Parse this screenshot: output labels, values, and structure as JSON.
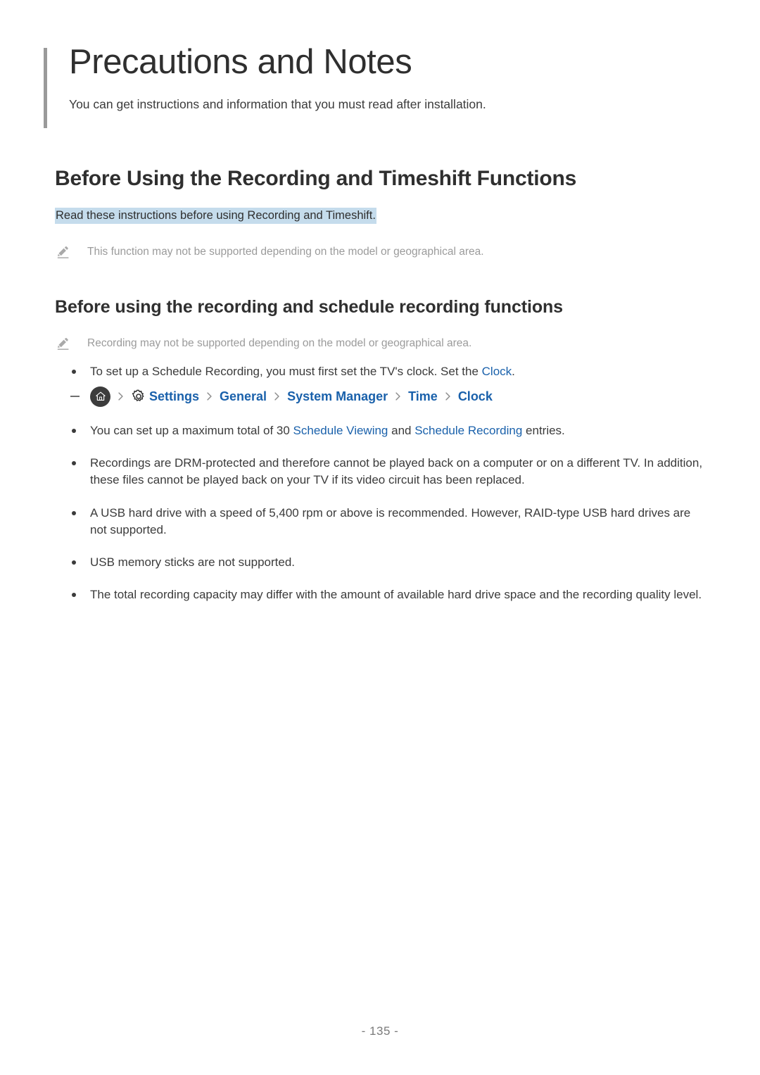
{
  "document": {
    "title": "Precautions and Notes",
    "subtitle": "You can get instructions and information that you must read after installation.",
    "page_number": "- 135 -"
  },
  "colors": {
    "link": "#1a61ab",
    "highlight": "#c5dcec",
    "note_text": "#9b9b9b",
    "body_text": "#3b3b3b",
    "accent_bar": "#9a9a9a"
  },
  "section1": {
    "heading": "Before Using the Recording and Timeshift Functions",
    "intro_highlighted": "Read these instructions before using Recording and Timeshift.",
    "note": {
      "icon": "pencil-icon",
      "text": "This function may not be supported depending on the model or geographical area."
    }
  },
  "section2": {
    "heading": "Before using the recording and schedule recording functions",
    "note": {
      "icon": "pencil-icon",
      "text": "Recording may not be supported depending on the model or geographical area."
    },
    "bullets": [
      {
        "parts": [
          {
            "type": "text",
            "value": "To set up a Schedule Recording, you must first set the TV's clock. Set the "
          },
          {
            "type": "link",
            "value": "Clock"
          },
          {
            "type": "text",
            "value": "."
          }
        ]
      },
      {
        "parts": [
          {
            "type": "text",
            "value": "You can set up a maximum total of 30 "
          },
          {
            "type": "link",
            "value": "Schedule Viewing"
          },
          {
            "type": "text",
            "value": " and "
          },
          {
            "type": "link",
            "value": "Schedule Recording"
          },
          {
            "type": "text",
            "value": " entries."
          }
        ]
      },
      {
        "parts": [
          {
            "type": "text",
            "value": "Recordings are DRM-protected and therefore cannot be played back on a computer or on a different TV. In addition, these files cannot be played back on your TV if its video circuit has been replaced."
          }
        ]
      },
      {
        "parts": [
          {
            "type": "text",
            "value": "A USB hard drive with a speed of 5,400 rpm or above is recommended. However, RAID-type USB hard drives are not supported."
          }
        ]
      },
      {
        "parts": [
          {
            "type": "text",
            "value": "USB memory sticks are not supported."
          }
        ]
      },
      {
        "parts": [
          {
            "type": "text",
            "value": "The total recording capacity may differ with the amount of available hard drive space and the recording quality level."
          }
        ]
      }
    ],
    "breadcrumb": {
      "dash_marker": "–",
      "home_icon": "home-icon",
      "gear_icon": "gear-icon",
      "separator": "chevron-right-icon",
      "items": [
        "Settings",
        "General",
        "System Manager",
        "Time",
        "Clock"
      ]
    }
  }
}
